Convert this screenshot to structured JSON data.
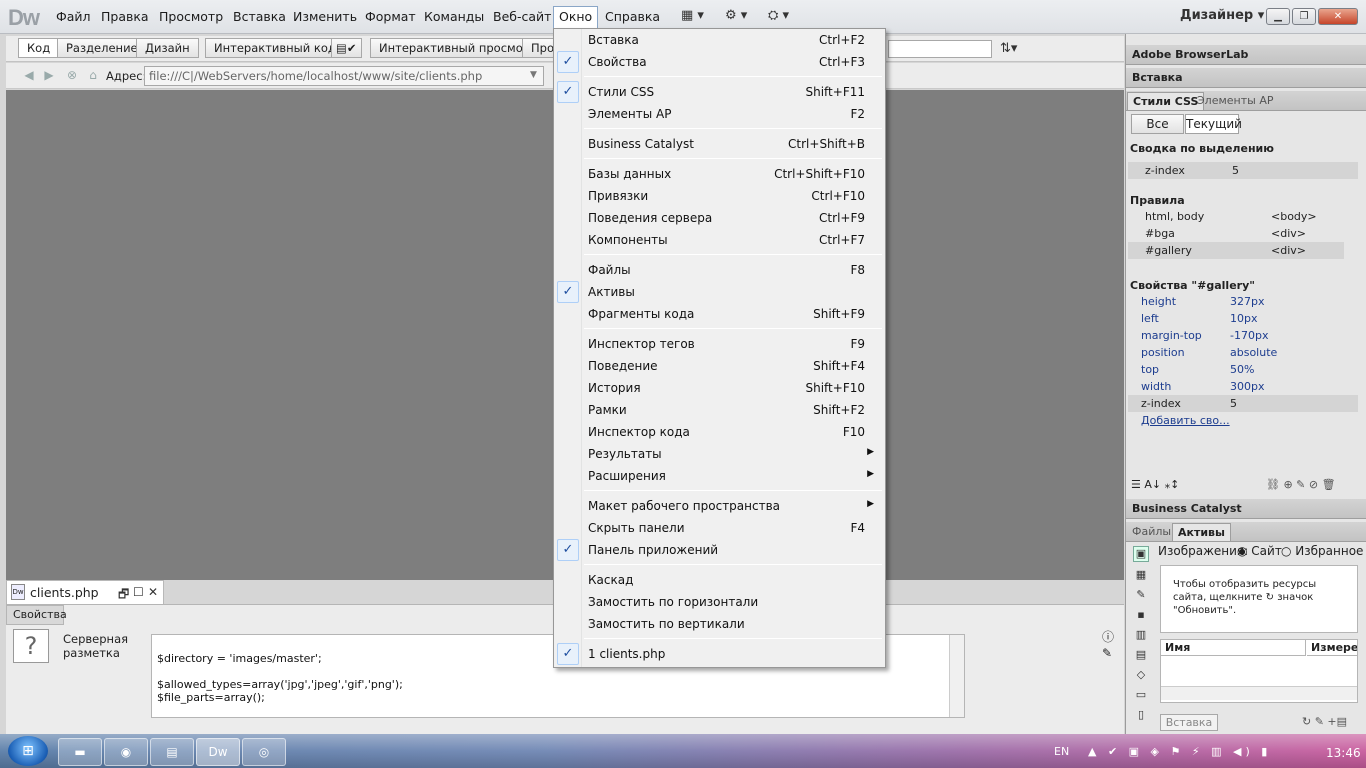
{
  "app": {
    "logo": "Dw",
    "workspace": "Дизайнер"
  },
  "menubar": {
    "items": [
      "Файл",
      "Правка",
      "Просмотр",
      "Вставка",
      "Изменить",
      "Формат",
      "Команды",
      "Веб-сайт",
      "Окно",
      "Справка"
    ],
    "active": "Окно"
  },
  "toolbar": {
    "code": "Код",
    "split": "Разделение",
    "design": "Дизайн",
    "live_code": "Интерактивный код",
    "live_view": "Интерактивный просмотр",
    "inspect_partial": "Про"
  },
  "addressbar": {
    "label": "Адрес:",
    "value": "file:///C|/WebServers/home/localhost/www/site/clients.php"
  },
  "document": {
    "tab_label": "clients.php"
  },
  "properties": {
    "tab": "Свойства",
    "server_markup": "Серверная разметка",
    "code_lines": [
      "",
      "$directory = 'images/master';",
      "",
      "$allowed_types=array('jpg','jpeg','gif','png');",
      "$file_parts=array();"
    ]
  },
  "window_menu": {
    "items": [
      {
        "label": "Вставка",
        "shortcut": "Ctrl+F2",
        "checked": false
      },
      {
        "label": "Свойства",
        "shortcut": "Ctrl+F3",
        "checked": true
      },
      {
        "label": "Стили CSS",
        "shortcut": "Shift+F11",
        "checked": true
      },
      {
        "label": "Элементы AP",
        "shortcut": "F2",
        "checked": false
      },
      {
        "label": "Business Catalyst",
        "shortcut": "Ctrl+Shift+B",
        "checked": false
      },
      {
        "label": "Базы данных",
        "shortcut": "Ctrl+Shift+F10",
        "checked": false
      },
      {
        "label": "Привязки",
        "shortcut": "Ctrl+F10",
        "checked": false
      },
      {
        "label": "Поведения сервера",
        "shortcut": "Ctrl+F9",
        "checked": false
      },
      {
        "label": "Компоненты",
        "shortcut": "Ctrl+F7",
        "checked": false
      },
      {
        "label": "Файлы",
        "shortcut": "F8",
        "checked": false
      },
      {
        "label": "Активы",
        "shortcut": "",
        "checked": true
      },
      {
        "label": "Фрагменты кода",
        "shortcut": "Shift+F9",
        "checked": false
      },
      {
        "label": "Инспектор тегов",
        "shortcut": "F9",
        "checked": false
      },
      {
        "label": "Поведение",
        "shortcut": "Shift+F4",
        "checked": false
      },
      {
        "label": "История",
        "shortcut": "Shift+F10",
        "checked": false
      },
      {
        "label": "Рамки",
        "shortcut": "Shift+F2",
        "checked": false
      },
      {
        "label": "Инспектор кода",
        "shortcut": "F10",
        "checked": false
      },
      {
        "label": "Результаты",
        "shortcut": "",
        "checked": false,
        "submenu": true
      },
      {
        "label": "Расширения",
        "shortcut": "",
        "checked": false,
        "submenu": true
      },
      {
        "label": "Макет рабочего пространства",
        "shortcut": "",
        "checked": false,
        "submenu": true
      },
      {
        "label": "Скрыть панели",
        "shortcut": "F4",
        "checked": false
      },
      {
        "label": "Панель приложений",
        "shortcut": "",
        "checked": true
      },
      {
        "label": "Каскад",
        "shortcut": "",
        "checked": false
      },
      {
        "label": "Замостить по горизонтали",
        "shortcut": "",
        "checked": false
      },
      {
        "label": "Замостить по вертикали",
        "shortcut": "",
        "checked": false
      },
      {
        "label": "1 clients.php",
        "shortcut": "",
        "checked": true
      }
    ]
  },
  "right_panels": {
    "browserlab": "Adobe BrowserLab",
    "insert": "Вставка",
    "css_tab": "Стили CSS",
    "ap_tab": "Элементы AP",
    "all_btn": "Все",
    "current_btn": "Текущий",
    "summary_title": "Сводка по выделению",
    "summary_row": {
      "key": "z-index",
      "value": "5"
    },
    "rules_title": "Правила",
    "rules": [
      {
        "selector": "html, body",
        "tag": "<body>"
      },
      {
        "selector": "#bga",
        "tag": "<div>"
      },
      {
        "selector": "#gallery",
        "tag": "<div>"
      }
    ],
    "props_title": "Свойства \"#gallery\"",
    "props": [
      {
        "key": "height",
        "value": "327px"
      },
      {
        "key": "left",
        "value": "10px"
      },
      {
        "key": "margin-top",
        "value": "-170px"
      },
      {
        "key": "position",
        "value": "absolute"
      },
      {
        "key": "top",
        "value": "50%"
      },
      {
        "key": "width",
        "value": "300px"
      },
      {
        "key": "z-index",
        "value": "5"
      }
    ],
    "add_property": "Добавить сво...",
    "business_catalyst": "Business Catalyst",
    "files_tab": "Файлы",
    "assets_tab": "Активы",
    "images_label": "Изображения:",
    "site_radio": "Сайт",
    "favorites_radio": "Избранное",
    "assets_message": "Чтобы отобразить ресурсы сайта, щелкните",
    "assets_message2": "значок \"Обновить\".",
    "col_name": "Имя",
    "col_size": "Измерен",
    "insert_btn": "Вставка"
  },
  "taskbar": {
    "lang": "EN",
    "clock": "13:46"
  },
  "colors": {
    "menu_check": "#1f4fa0",
    "link": "#1d3d8f",
    "doc_bg": "#7e7e7e"
  }
}
